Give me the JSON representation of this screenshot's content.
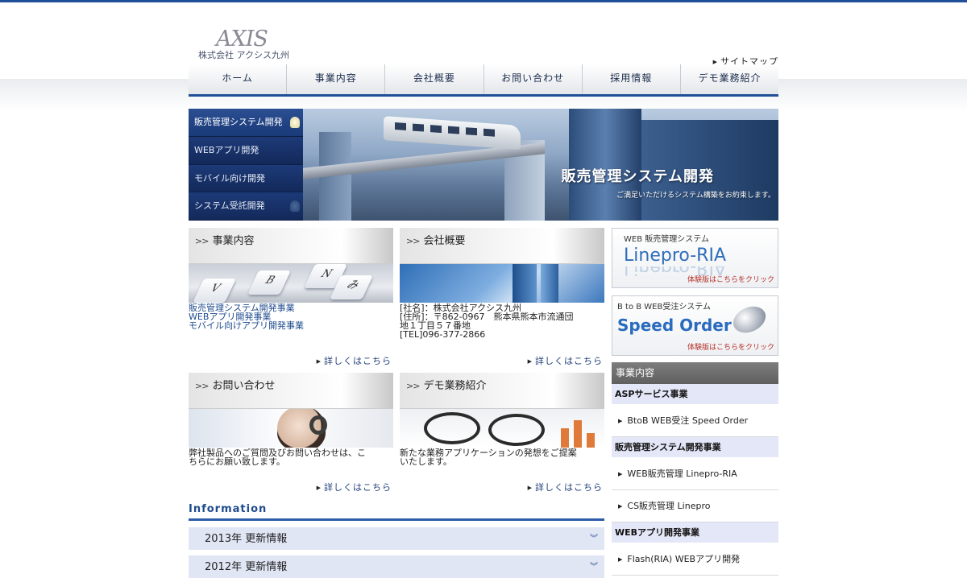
{
  "header": {
    "logo_mark": "AXIS",
    "logo_company": "株式会社 アクシス九州",
    "sitemap_label": "サイトマップ"
  },
  "nav": {
    "items": [
      {
        "label": "ホーム"
      },
      {
        "label": "事業内容"
      },
      {
        "label": "会社概要"
      },
      {
        "label": "お問い合わせ"
      },
      {
        "label": "採用情報"
      },
      {
        "label": "デモ業務紹介"
      }
    ]
  },
  "hero": {
    "menu": [
      {
        "label": "販売管理システム開発",
        "active": true
      },
      {
        "label": "WEBアプリ開発",
        "active": false
      },
      {
        "label": "モバイル向け開発",
        "active": false
      },
      {
        "label": "システム受託開発",
        "active": false
      }
    ],
    "title": "販売管理システム開発",
    "caption": "ご満足いただけるシステム構築をお約束します。"
  },
  "panels": {
    "business": {
      "title": "事業内容",
      "links": [
        "販売管理システム開発事業",
        "WEBアプリ開発事業",
        "モバイル向けアプリ開発事業"
      ],
      "more": "詳しくはこちら",
      "keys": [
        "V",
        "B",
        "N",
        "み"
      ]
    },
    "company": {
      "title": "会社概要",
      "lines": [
        "[社名]：株式会社アクシス九州",
        "[住所]：〒862-0967　熊本県熊本市流通団",
        "地１丁目５７番地",
        "[TEL]096-377-2866"
      ],
      "more": "詳しくはこちら"
    },
    "contact": {
      "title": "お問い合わせ",
      "lines": [
        "弊社製品へのご質問及びお問い合わせは、こ",
        "ちらにお願い致します。"
      ],
      "more": "詳しくはこちら"
    },
    "demo": {
      "title": "デモ業務紹介",
      "lines": [
        "新たな業務アプリケーションの発想をご提案",
        "いたします。"
      ],
      "more": "詳しくはこちら"
    }
  },
  "information": {
    "title": "Information",
    "rows": [
      {
        "label": "2013年 更新情報"
      },
      {
        "label": "2012年 更新情報"
      }
    ]
  },
  "sidebar": {
    "banner1": {
      "small": "WEB 販売管理システム",
      "big": "Linepro-RIA",
      "note": "体験版はこちらをクリック"
    },
    "banner2": {
      "small": "B to B  WEB受注システム",
      "big": "Speed Order",
      "note": "体験版はこちらをクリック"
    },
    "heading": "事業内容",
    "sections": [
      {
        "category": "ASPサービス事業",
        "links": [
          "BtoB WEB受注 Speed Order"
        ]
      },
      {
        "category": "販売管理システム開発事業",
        "links": [
          "WEB販売管理 Linepro-RIA",
          "CS販売管理 Linepro"
        ]
      },
      {
        "category": "WEBアプリ開発事業",
        "links": [
          "Flash(RIA) WEBアプリ開発"
        ]
      }
    ]
  },
  "colors": {
    "brand_blue": "#1f4f96",
    "link_blue": "#1f4b8f",
    "info_row_bg": "#e1e6f5",
    "sidebar_heading_bg": "#6e6e6e"
  }
}
